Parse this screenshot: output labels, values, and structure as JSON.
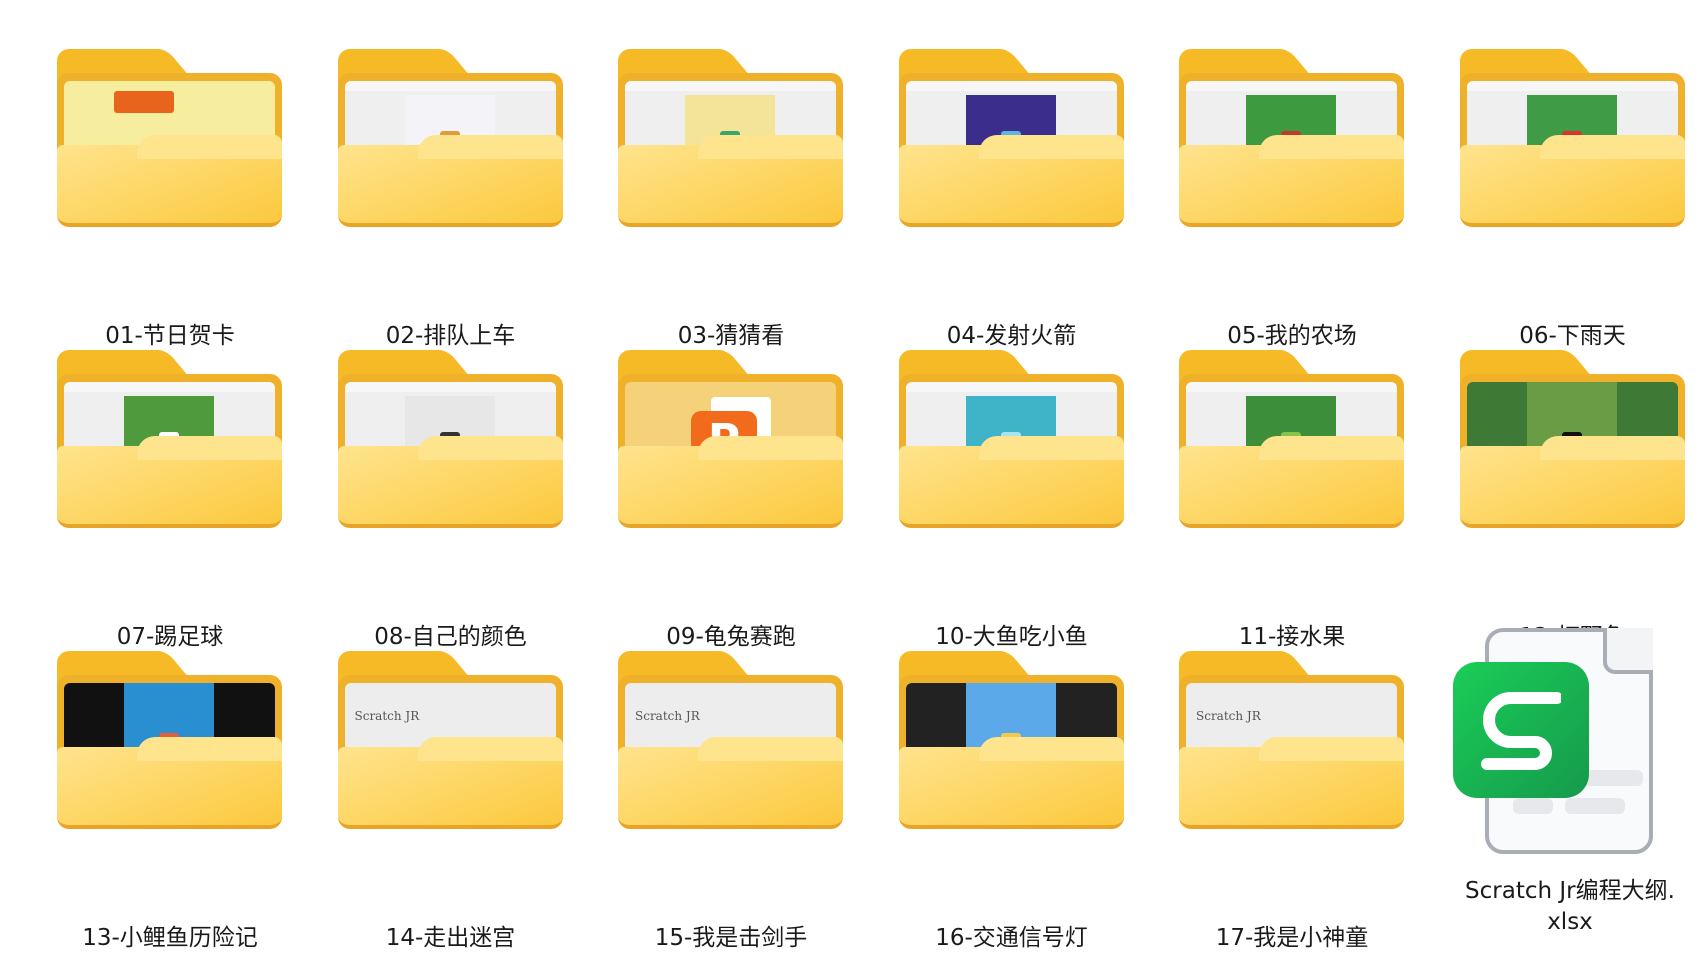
{
  "folders": [
    {
      "name": "01-节日贺卡",
      "thumb": {
        "bg": "#F7ED9F",
        "pic": "#F7ED9F",
        "accent": "#E8641C",
        "frame": "#111111"
      }
    },
    {
      "name": "02-排队上车",
      "thumb": {
        "bg": "#EFEFEF",
        "pic": "#F4F4F8",
        "accent": "#E59A3A"
      }
    },
    {
      "name": "03-猜猜看",
      "thumb": {
        "bg": "#EFEFEF",
        "pic": "#F3E49A",
        "accent": "#3AA66A"
      }
    },
    {
      "name": "04-发射火箭",
      "thumb": {
        "bg": "#EFEFEF",
        "pic": "#3B2D8C",
        "accent": "#5BB5E0"
      }
    },
    {
      "name": "05-我的农场",
      "thumb": {
        "bg": "#EFEFEF",
        "pic": "#3E9A3E",
        "accent": "#C0392B"
      }
    },
    {
      "name": "06-下雨天",
      "thumb": {
        "bg": "#EFEFEF",
        "pic": "#3F9B46",
        "accent": "#D9342B"
      }
    },
    {
      "name": "07-踢足球",
      "thumb": {
        "bg": "#EFEFEF",
        "pic": "#4E9A3C",
        "accent": "#FFFFFF"
      }
    },
    {
      "name": "08-自己的颜色",
      "thumb": {
        "bg": "#EFEFEF",
        "pic": "#E7E7E7",
        "accent": "#333333"
      }
    },
    {
      "name": "09-龟兔赛跑",
      "thumb": {
        "bg": "#F5D27A",
        "pic": "",
        "accent": "#F26B1D"
      },
      "ppt": "P"
    },
    {
      "name": "10-大鱼吃小鱼",
      "thumb": {
        "bg": "#EFEFEF",
        "pic": "#3FB4C9",
        "accent": "#A7E3F0"
      }
    },
    {
      "name": "11-接水果",
      "thumb": {
        "bg": "#EFEFEF",
        "pic": "#3C8E3A",
        "accent": "#8BC34A"
      }
    },
    {
      "name": "12-打野兔",
      "thumb": {
        "bg": "#3E7A35",
        "pic": "#6A9C45",
        "accent": "#111111"
      }
    },
    {
      "name": "13-小鲤鱼历险记",
      "thumb": {
        "bg": "#111111",
        "pic": "#2A8FD0",
        "accent": "#E45C3A"
      }
    },
    {
      "name": "14-走出迷宫",
      "thumb": {
        "bg": "#EDEDED",
        "pic": "",
        "accent": ""
      },
      "text": "Scratch JR"
    },
    {
      "name": "15-我是击剑手",
      "thumb": {
        "bg": "#EDEDED",
        "pic": "",
        "accent": ""
      },
      "text": "Scratch JR"
    },
    {
      "name": "16-交通信号灯",
      "thumb": {
        "bg": "#222222",
        "pic": "#5BA9E8",
        "accent": "#F2C94C"
      }
    },
    {
      "name": "17-我是小神童",
      "thumb": {
        "bg": "#EDEDED",
        "pic": "",
        "accent": ""
      },
      "text": "Scratch JR"
    }
  ],
  "file": {
    "name_line1": "Scratch Jr编程大纲.",
    "name_line2": "xlsx",
    "icon": "wps-spreadsheet-icon",
    "color": "#1ACD57"
  }
}
